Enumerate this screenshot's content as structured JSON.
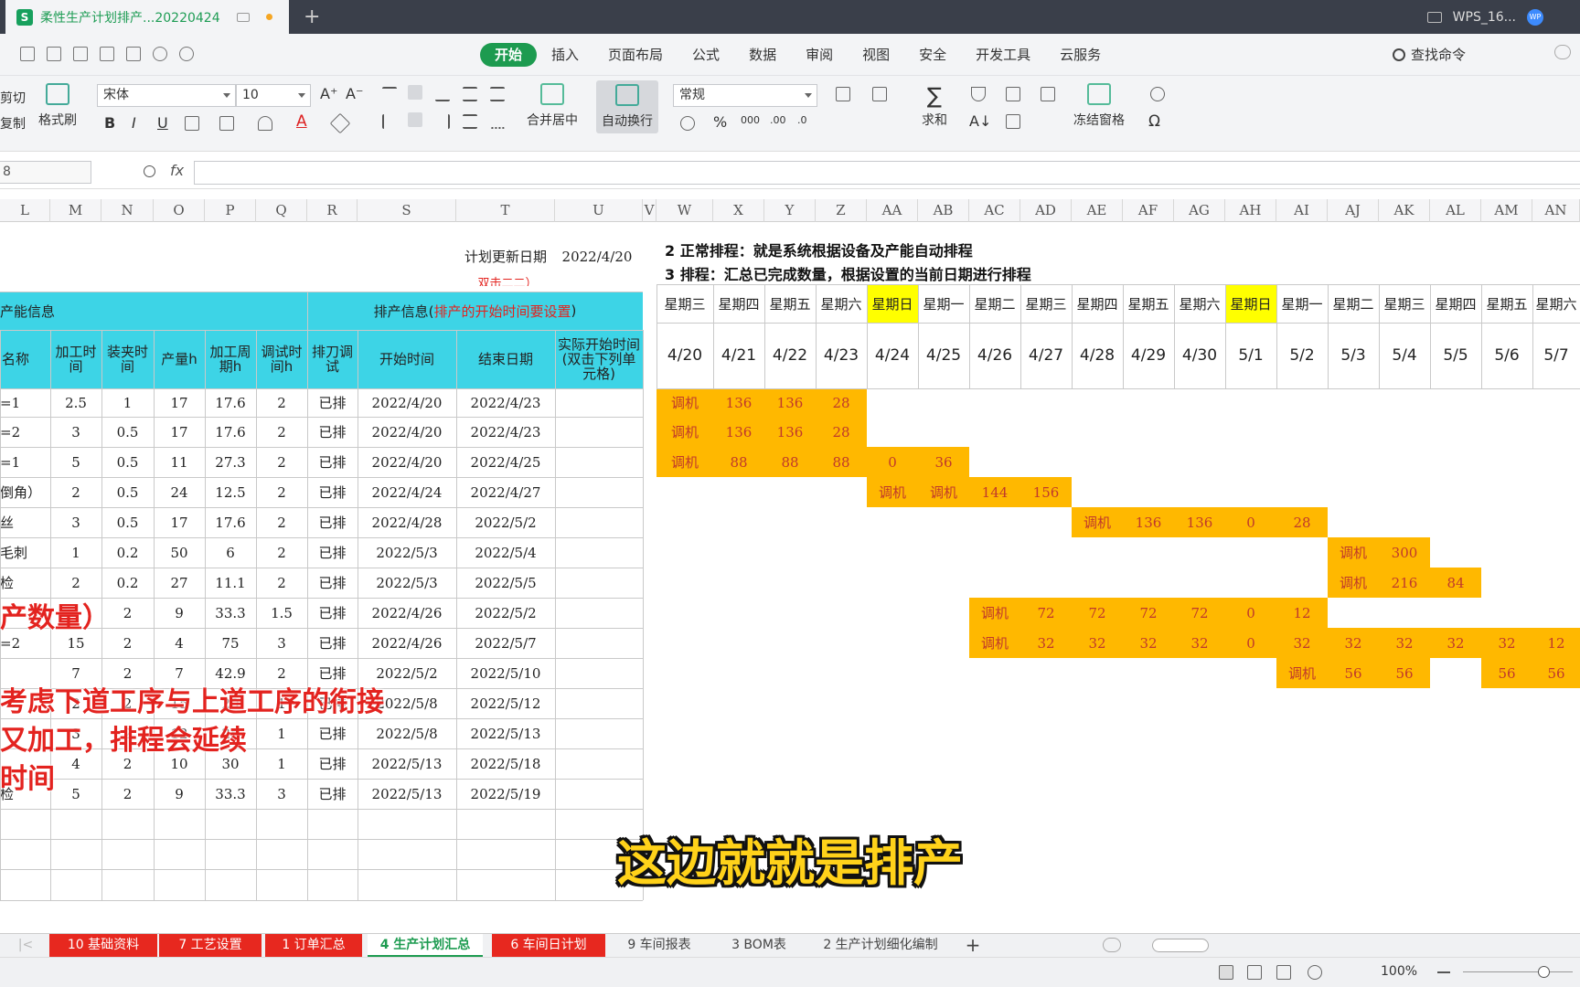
{
  "window": {
    "doc_title": "柔性生产计划排产...20220424",
    "app_name": "WPS_16...",
    "wps_badge": "WP"
  },
  "menus": [
    "开始",
    "插入",
    "页面布局",
    "公式",
    "数据",
    "审阅",
    "视图",
    "安全",
    "开发工具",
    "云服务"
  ],
  "search_command": "查找命令",
  "ribbon": {
    "cut": "剪切",
    "copy": "复制",
    "format_painter": "格式刷",
    "font": "宋体",
    "font_size": "10",
    "number_format": "常规",
    "merge_center": "合并居中",
    "auto_wrap": "自动换行",
    "sum": "求和",
    "freeze": "冻结窗格"
  },
  "formula_bar": {
    "name_box": "8",
    "fx": "fx"
  },
  "columns": [
    "L",
    "M",
    "N",
    "O",
    "P",
    "Q",
    "R",
    "S",
    "T",
    "U",
    "V",
    "W",
    "X",
    "Y",
    "Z",
    "AA",
    "AB",
    "AC",
    "AD",
    "AE",
    "AF",
    "AG",
    "AH",
    "AI",
    "AJ",
    "AK",
    "AL",
    "AM",
    "AN"
  ],
  "header_info": {
    "plan_update_label": "计划更新日期",
    "plan_update_date": "2022/4/20",
    "double_click_hint": "双击二二）",
    "note_line1": "2 正常排程：就是系统根据设备及产能自动排程",
    "note_line2": "3 排程：汇总已完成数量，根据设置的当前日期进行排程"
  },
  "group_headers": {
    "capacity": "产能信息",
    "schedule_prefix": "排产信息(",
    "schedule_red": "排产的开始时间要设置",
    "schedule_suffix": ")"
  },
  "table_headers": [
    "名称",
    "加工时间",
    "装夹时间",
    "产量h",
    "加工周期h",
    "调试时间h",
    "排刀调试",
    "开始时间",
    "结束日期",
    "实际开始时间(双击下列单元格)"
  ],
  "rows": [
    [
      "=1",
      "2.5",
      "1",
      "17",
      "17.6",
      "2",
      "已排",
      "2022/4/20",
      "2022/4/23"
    ],
    [
      "=2",
      "3",
      "0.5",
      "17",
      "17.6",
      "2",
      "已排",
      "2022/4/20",
      "2022/4/23"
    ],
    [
      "=1",
      "5",
      "0.5",
      "11",
      "27.3",
      "2",
      "已排",
      "2022/4/20",
      "2022/4/25"
    ],
    [
      "倒角）",
      "2",
      "0.5",
      "24",
      "12.5",
      "2",
      "已排",
      "2022/4/24",
      "2022/4/27"
    ],
    [
      "丝",
      "3",
      "0.5",
      "17",
      "17.6",
      "2",
      "已排",
      "2022/4/28",
      "2022/5/2"
    ],
    [
      "毛刺",
      "1",
      "0.2",
      "50",
      "6",
      "2",
      "已排",
      "2022/5/3",
      "2022/5/4"
    ],
    [
      "检",
      "2",
      "0.2",
      "27",
      "11.1",
      "2",
      "已排",
      "2022/5/3",
      "2022/5/5"
    ],
    [
      "",
      "",
      "2",
      "9",
      "33.3",
      "1.5",
      "已排",
      "2022/4/26",
      "2022/5/2"
    ],
    [
      "=2",
      "15",
      "2",
      "4",
      "75",
      "3",
      "已排",
      "2022/4/26",
      "2022/5/7"
    ],
    [
      "",
      "7",
      "2",
      "7",
      "42.9",
      "2",
      "已排",
      "2022/5/2",
      "2022/5/10"
    ],
    [
      "",
      "2",
      "2",
      "15",
      "20",
      "1",
      "已排",
      "2022/5/8",
      "2022/5/12"
    ],
    [
      "",
      "3",
      "2",
      "12",
      "25",
      "1",
      "已排",
      "2022/5/8",
      "2022/5/13"
    ],
    [
      "",
      "4",
      "2",
      "10",
      "30",
      "1",
      "已排",
      "2022/5/13",
      "2022/5/18"
    ],
    [
      "检",
      "5",
      "2",
      "9",
      "33.3",
      "3",
      "已排",
      "2022/5/13",
      "2022/5/19"
    ]
  ],
  "weekdays": [
    "星期三",
    "星期四",
    "星期五",
    "星期六",
    "星期日",
    "星期一",
    "星期二",
    "星期三",
    "星期四",
    "星期五",
    "星期六",
    "星期日",
    "星期一",
    "星期二",
    "星期三",
    "星期四",
    "星期五",
    "星期六"
  ],
  "dates": [
    "4/20",
    "4/21",
    "4/22",
    "4/23",
    "4/24",
    "4/25",
    "4/26",
    "4/27",
    "4/28",
    "4/29",
    "4/30",
    "5/1",
    "5/2",
    "5/3",
    "5/4",
    "5/5",
    "5/6",
    "5/7"
  ],
  "gantt": [
    [
      0,
      "调机"
    ],
    [
      0,
      "136"
    ],
    [
      0,
      "136"
    ],
    [
      0,
      "28"
    ]
  ],
  "gantt_rows": [
    {
      "start": 0,
      "cells": [
        "调机",
        "136",
        "136",
        "28"
      ]
    },
    {
      "start": 0,
      "cells": [
        "调机",
        "136",
        "136",
        "28"
      ]
    },
    {
      "start": 0,
      "cells": [
        "调机",
        "88",
        "88",
        "88",
        "0",
        "36"
      ]
    },
    {
      "start": 4,
      "cells": [
        "调机",
        "调机",
        "144",
        "156"
      ]
    },
    {
      "start": 8,
      "cells": [
        "调机",
        "136",
        "136",
        "0",
        "28"
      ]
    },
    {
      "start": 13,
      "cells": [
        "调机",
        "300"
      ]
    },
    {
      "start": 13,
      "cells": [
        "调机",
        "216",
        "84"
      ]
    },
    {
      "start": 6,
      "cells": [
        "调机",
        "72",
        "72",
        "72",
        "72",
        "0",
        "12"
      ]
    },
    {
      "start": 6,
      "cells": [
        "调机",
        "32",
        "32",
        "32",
        "32",
        "0",
        "32",
        "32",
        "32",
        "32",
        "32",
        "12"
      ]
    },
    {
      "start": 12,
      "cells": [
        "调机",
        "56",
        "56",
        "",
        "56",
        "56"
      ]
    }
  ],
  "overlay_text": {
    "line1": "产数量）",
    "line2": "考虑下道工序与上道工序的衔接",
    "line3": "又加工，排程会延续",
    "line4": "时间"
  },
  "subtitle": "这边就就是排产",
  "sheet_tabs": [
    {
      "label": "10 基础资料",
      "style": "red"
    },
    {
      "label": "7 工艺设置",
      "style": "red"
    },
    {
      "label": "1 订单汇总",
      "style": "red"
    },
    {
      "label": "4 生产计划汇总",
      "style": "active"
    },
    {
      "label": "6 车间日计划",
      "style": "red"
    },
    {
      "label": "9 车间报表",
      "style": "normal"
    },
    {
      "label": "3 BOM表",
      "style": "normal"
    },
    {
      "label": "2 生产计划细化编制",
      "style": "normal"
    }
  ],
  "status": {
    "zoom": "100%"
  },
  "colors": {
    "cyan": "#3dd4e6",
    "orange": "#ffb800",
    "yellow": "#ffff00",
    "red_tab": "#e7281f",
    "green": "#1d9b50"
  }
}
